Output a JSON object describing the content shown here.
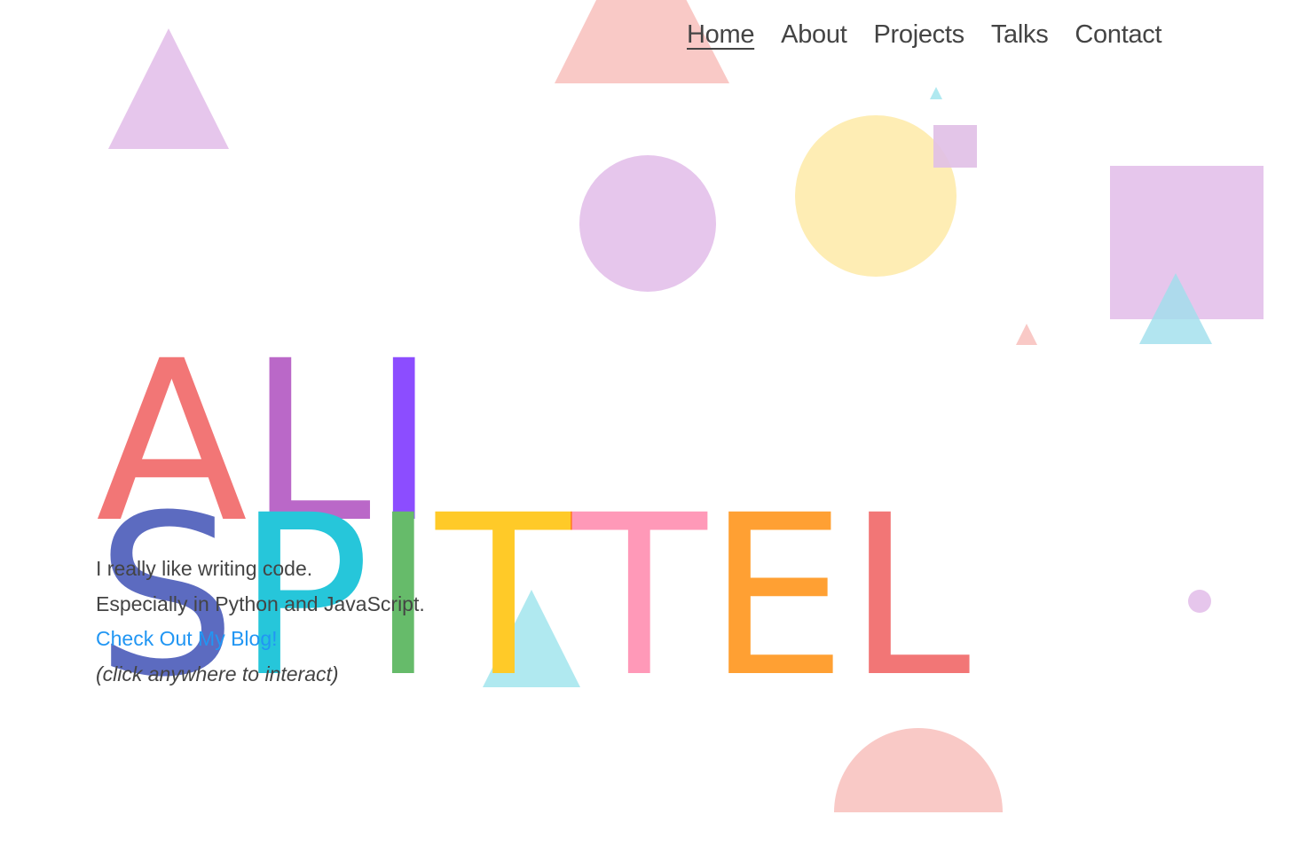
{
  "nav": {
    "items": [
      {
        "label": "Home",
        "active": true
      },
      {
        "label": "About",
        "active": false
      },
      {
        "label": "Projects",
        "active": false
      },
      {
        "label": "Talks",
        "active": false
      },
      {
        "label": "Contact",
        "active": false
      }
    ]
  },
  "hero": {
    "first_name": [
      "A",
      "L",
      "I"
    ],
    "last_name": [
      "S",
      "P",
      "I",
      "T",
      "T",
      "E",
      "L"
    ],
    "first_colors": [
      "#f27676",
      "#ba68c8",
      "#8c4dff"
    ],
    "last_colors": [
      "#5c6bc0",
      "#26c6da",
      "#66bb6a",
      "#ffca28",
      "#ff99b8",
      "#ffa033",
      "#f27676"
    ]
  },
  "intro": {
    "line1": "I really like writing code.",
    "line2": "Especially in Python and JavaScript.",
    "blog_link": "Check Out My Blog!",
    "hint": "(click anywhere to interact)"
  },
  "colors": {
    "text": "#444444",
    "link": "#2196f3",
    "shape_pink": "#f9c9c6",
    "shape_purple": "#e6c6ec",
    "shape_yellow": "#feedb4",
    "shape_cyan": "#b0e9f0"
  }
}
